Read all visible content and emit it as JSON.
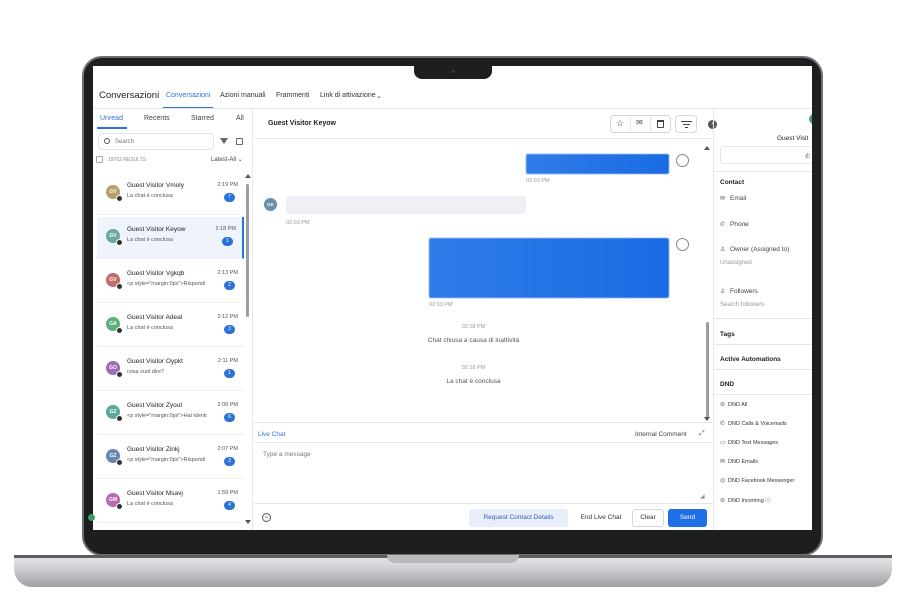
{
  "app": {
    "title": "Conversazioni"
  },
  "nav": {
    "tabs": [
      "Conversazioni",
      "Azioni manuali",
      "Frammenti",
      "Link di attivazione"
    ]
  },
  "list": {
    "tabs": [
      "Unread",
      "Recents",
      "Starred",
      "All"
    ],
    "search_placeholder": "Search",
    "results": "19702 RESULTS",
    "sort": "Latest-All",
    "items": [
      {
        "initials": "GV",
        "color": "#b3a06b",
        "name": "Guest Visitor Vmoly",
        "time": "2:19 PM",
        "preview": "La chat è conclusa",
        "count": "7"
      },
      {
        "initials": "GV",
        "color": "#6aa8a4",
        "name": "Guest Visitor Keyow",
        "time": "2:18 PM",
        "preview": "La chat è conclusa",
        "count": "1"
      },
      {
        "initials": "GV",
        "color": "#c46a6a",
        "name": "Guest Visitor Vgkqb",
        "time": "2:13 PM",
        "preview": "<p style=\"margin:0px\">Rispondi",
        "count": "2"
      },
      {
        "initials": "GA",
        "color": "#5fae7a",
        "name": "Guest Visitor Adeal",
        "time": "2:12 PM",
        "preview": "La chat è conclusa",
        "count": "3"
      },
      {
        "initials": "GO",
        "color": "#a06ab8",
        "name": "Guest Visitor Oypkt",
        "time": "2:11 PM",
        "preview": "cosa vuol dire?",
        "count": "1"
      },
      {
        "initials": "GZ",
        "color": "#5aa8a0",
        "name": "Guest Visitor Zyout",
        "time": "2:08 PM",
        "preview": "<p style=\"margin:0px\">Hai identi",
        "count": "6"
      },
      {
        "initials": "GZ",
        "color": "#6a84b8",
        "name": "Guest Visitor Zinkj",
        "time": "2:07 PM",
        "preview": "<p style=\"margin:0px\">Rispondi",
        "count": "3"
      },
      {
        "initials": "GM",
        "color": "#b86ab0",
        "name": "Guest Visitor Msavj",
        "time": "1:59 PM",
        "preview": "La chat è conclusa",
        "count": "4"
      }
    ]
  },
  "chat": {
    "title": "Guest Visitor Keyow",
    "visitor_initials": "GK",
    "messages": [
      {
        "time": "02:03 PM"
      },
      {
        "time": "02:03 PM"
      },
      {
        "time": "02:03 PM"
      }
    ],
    "system": [
      {
        "time": "02:18 PM",
        "text": "Chat chiusa a causa di inattività"
      },
      {
        "time": "02:18 PM",
        "text": "La chat è conclusa"
      }
    ]
  },
  "composer": {
    "tab_live": "Live Chat",
    "tab_internal": "Internal Comment",
    "placeholder": "Type a message",
    "request_label": "Request Contact Details",
    "end_label": "End Live Chat",
    "clear_label": "Clear",
    "send_label": "Send"
  },
  "contact": {
    "name": "Guest Visit",
    "section_contact": "Contact",
    "email": "Email",
    "phone": "Phone",
    "owner": "Owner (Assigned to)",
    "owner_value": "Unassigned",
    "followers": "Followers",
    "followers_placeholder": "Search followers",
    "tags": "Tags",
    "automations": "Active Automations",
    "dnd": "DND",
    "dnd_items": [
      "DND All",
      "DND Calls & Voicemails",
      "DND Text Messages",
      "DND Emails",
      "DND Facebook Messenger",
      "DND Incoming"
    ]
  },
  "colors": {
    "accent": "#2b73d6",
    "send": "#1f6fe6"
  }
}
